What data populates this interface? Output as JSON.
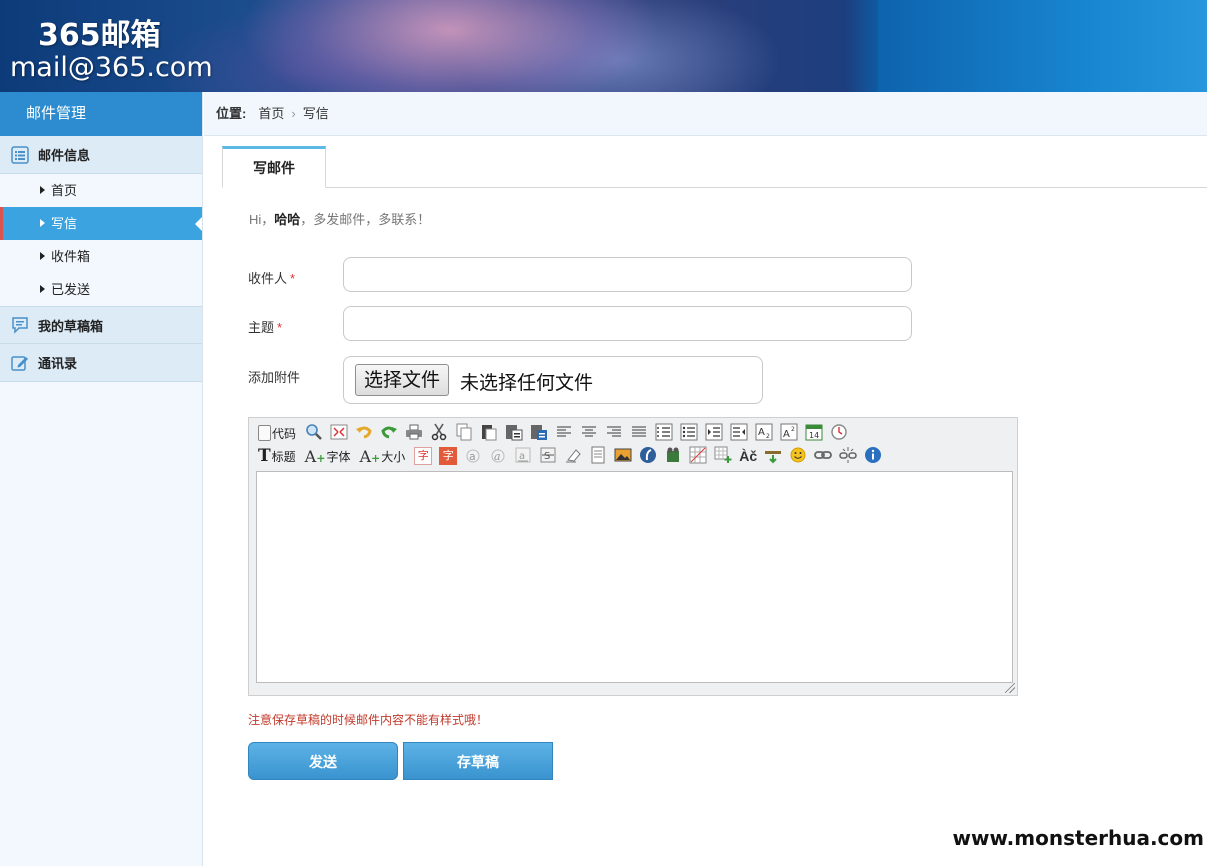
{
  "header": {
    "brand": "365邮箱",
    "email": "mail@365.com"
  },
  "sidebar": {
    "title": "邮件管理",
    "groups": [
      {
        "label": "邮件信息",
        "icon": "list-icon"
      },
      {
        "label": "我的草稿箱",
        "icon": "chat-icon"
      },
      {
        "label": "通讯录",
        "icon": "edit-icon"
      }
    ],
    "items": [
      {
        "label": "首页"
      },
      {
        "label": "写信",
        "active": true
      },
      {
        "label": "收件箱"
      },
      {
        "label": "已发送"
      }
    ]
  },
  "breadcrumb": {
    "label": "位置:",
    "home": "首页",
    "current": "写信"
  },
  "tab": {
    "label": "写邮件"
  },
  "greeting": {
    "prefix": "Hi，",
    "name": "哈哈",
    "suffix": "，多发邮件，多联系！"
  },
  "form": {
    "recipient_label": "收件人",
    "subject_label": "主题",
    "attachment_label": "添加附件",
    "required_mark": "*",
    "file_button": "选择文件",
    "file_status": "未选择任何文件"
  },
  "editor": {
    "row1": [
      "代码",
      "search-icon",
      "fullscreen-icon",
      "undo-icon",
      "redo-icon",
      "print-icon",
      "cut-icon",
      "copy-icon",
      "paste-icon",
      "paste-text-icon",
      "paste-word-icon",
      "align-left-icon",
      "align-center-icon",
      "align-right-icon",
      "align-justify-icon",
      "ordered-list-icon",
      "unordered-list-icon",
      "indent-icon",
      "outdent-icon",
      "subscript-icon",
      "superscript-icon",
      "date-icon",
      "time-icon"
    ],
    "row2": [
      "标题",
      "字体",
      "大小",
      "font-color-icon",
      "bg-color-icon",
      "bold-icon",
      "italic-icon",
      "underline-icon",
      "strikethrough-icon",
      "remove-format-icon",
      "select-all-icon",
      "image-icon",
      "flash-icon",
      "media-icon",
      "table-icon",
      "hr-icon",
      "emoticon-icon",
      "special-char-icon",
      "link-icon",
      "unlink-icon",
      "about-icon"
    ],
    "labels": {
      "code": "代码",
      "heading": "标题",
      "font": "字体",
      "size": "大小",
      "fg": "字",
      "bg": "字",
      "spell": "Àč"
    }
  },
  "note": "注意保存草稿的时候邮件内容不能有样式哦！",
  "buttons": {
    "send": "发送",
    "draft": "存草稿"
  },
  "watermark": "www.monsterhua.com"
}
